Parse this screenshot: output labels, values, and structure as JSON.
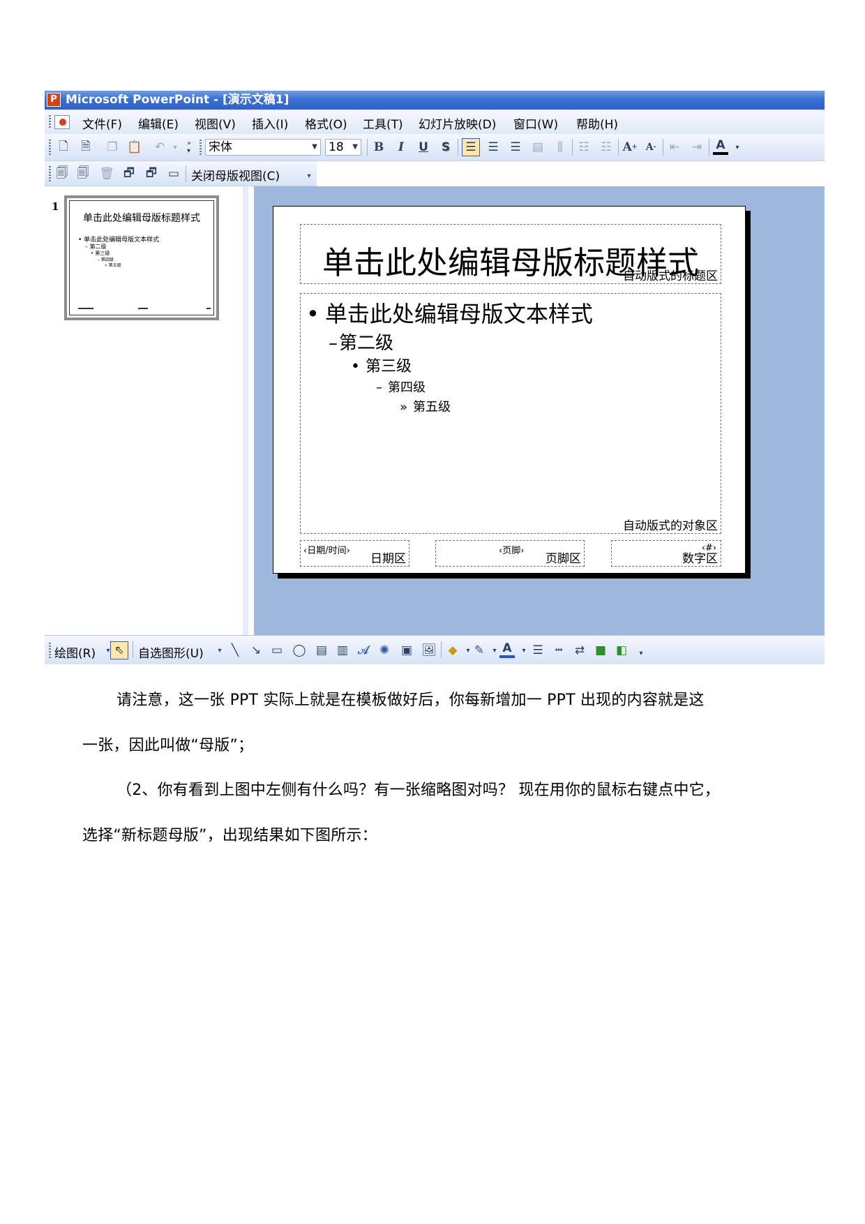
{
  "window": {
    "title": "Microsoft PowerPoint - [演示文稿1]"
  },
  "menu": [
    "文件(F)",
    "编辑(E)",
    "视图(V)",
    "插入(I)",
    "格式(O)",
    "工具(T)",
    "幻灯片放映(D)",
    "窗口(W)",
    "帮助(H)"
  ],
  "formatting": {
    "font": "宋体",
    "size": "18",
    "bold": "B",
    "italic": "I",
    "underline": "U",
    "shadow": "S",
    "font_color": "A"
  },
  "master_toolbar": {
    "close_label": "关闭母版视图(C)"
  },
  "thumbnail": {
    "number": "1",
    "title": "单击此处编辑母版标题样式",
    "lines": [
      "• 单击此处编辑母版文本样式",
      "– 第二级",
      "• 第三级",
      "– 第四级",
      "» 第五级"
    ]
  },
  "slide": {
    "title": "单击此处编辑母版标题样式",
    "title_area_label": "自动版式的标题区",
    "levels": [
      {
        "bullet": "•",
        "text": "单击此处编辑母版文本样式"
      },
      {
        "bullet": "–",
        "text": "第二级"
      },
      {
        "bullet": "•",
        "text": "第三级"
      },
      {
        "bullet": "–",
        "text": "第四级"
      },
      {
        "bullet": "»",
        "text": "第五级"
      }
    ],
    "object_area_label": "自动版式的对象区",
    "date_sub": "‹日期/时间›",
    "date_label": "日期区",
    "footer_sub": "‹页脚›",
    "footer_label": "页脚区",
    "number_sub": "‹#›",
    "number_label": "数字区"
  },
  "drawing": {
    "draw_label": "绘图(R)",
    "autoshape_label": "自选图形(U)"
  },
  "document": {
    "para1_line1": "请注意，这一张 PPT 实际上就是在模板做好后，你每新增加一 PPT 出现的内容就是这",
    "para1_line2": "一张，因此叫做“母版”；",
    "para2_line1": "（2、你有看到上图中左侧有什么吗？有一张缩略图对吗？ 现在用你的鼠标右键点中它，",
    "para2_line2": "选择“新标题母版”，出现结果如下图所示："
  }
}
